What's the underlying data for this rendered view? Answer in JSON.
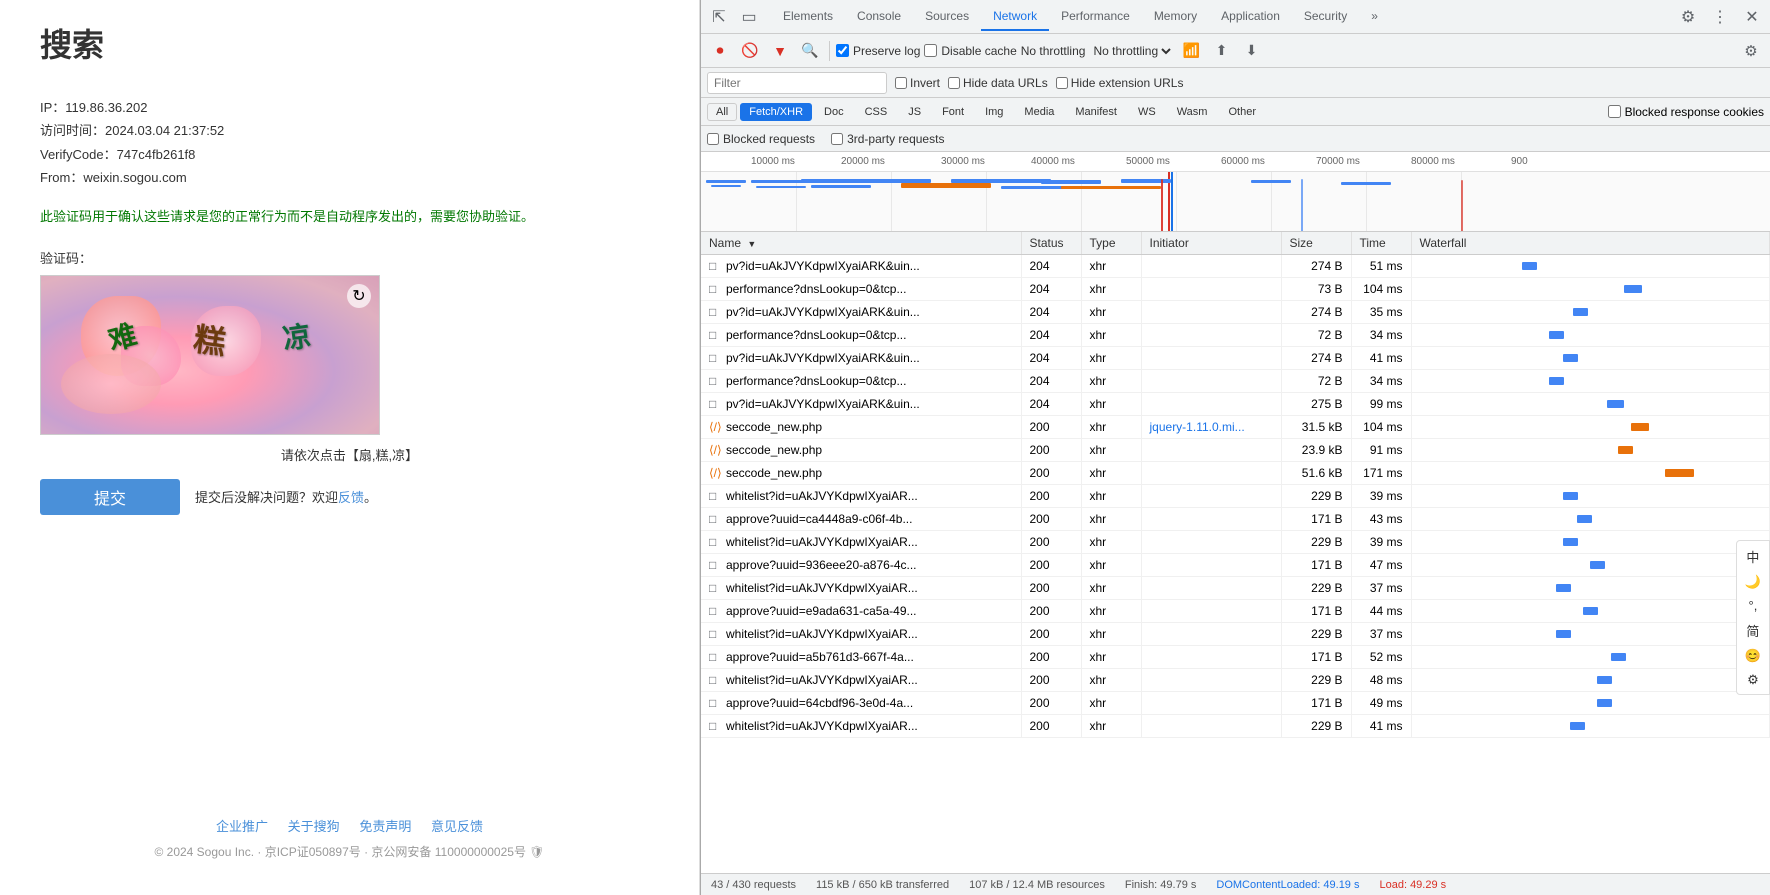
{
  "sogou": {
    "title": "搜索",
    "info": {
      "ip": "IP：119.86.36.202",
      "visit_time": "访问时间：2024.03.04 21:37:52",
      "verify_code": "VerifyCode：747c4fb261f8",
      "from": "From：weixin.sogou.com"
    },
    "description": "此验证码用于确认这些请求是您的正常行为而不是自动程序发出的，需要您协助验证。",
    "captcha_label": "验证码：",
    "captcha_chars": [
      "难",
      "糕",
      "凉"
    ],
    "captcha_instruction": "请依次点击【扇,糕,凉】",
    "submit_btn": "提交",
    "submit_hint": "提交后没解决问题？欢迎",
    "feedback_link": "反馈",
    "footer_links": [
      "企业推广",
      "关于搜狗",
      "免责声明",
      "意见反馈"
    ],
    "copyright": "© 2024 Sogou Inc. · 京ICP证050897号 · 京公网安备 110000000025号 🛡"
  },
  "devtools": {
    "tabs": [
      {
        "id": "elements",
        "label": "Elements",
        "active": false
      },
      {
        "id": "console",
        "label": "Console",
        "active": false
      },
      {
        "id": "sources",
        "label": "Sources",
        "active": false
      },
      {
        "id": "network",
        "label": "Network",
        "active": true
      },
      {
        "id": "performance",
        "label": "Performance",
        "active": false
      },
      {
        "id": "memory",
        "label": "Memory",
        "active": false
      },
      {
        "id": "application",
        "label": "Application",
        "active": false
      },
      {
        "id": "security",
        "label": "Security",
        "active": false
      }
    ],
    "toolbar": {
      "preserve_log_label": "Preserve log",
      "disable_cache_label": "Disable cache",
      "no_throttling_label": "No throttling"
    },
    "filter": {
      "placeholder": "Filter",
      "invert_label": "Invert",
      "hide_data_urls_label": "Hide data URLs",
      "hide_ext_urls_label": "Hide extension URLs"
    },
    "type_filters": [
      "All",
      "Fetch/XHR",
      "Doc",
      "CSS",
      "JS",
      "Font",
      "Img",
      "Media",
      "Manifest",
      "WS",
      "Wasm",
      "Other"
    ],
    "active_type_filter": "Fetch/XHR",
    "blocked_cookies_label": "Blocked response cookies",
    "extra_filters": [
      "Blocked requests",
      "3rd-party requests"
    ],
    "timeline_labels": [
      "10000 ms",
      "20000 ms",
      "30000 ms",
      "40000 ms",
      "50000 ms",
      "60000 ms",
      "70000 ms",
      "80000 ms",
      "900"
    ],
    "table": {
      "headers": [
        "Name",
        "Status",
        "Type",
        "Initiator",
        "Size",
        "Time",
        "Waterfall"
      ],
      "rows": [
        {
          "name": "pv?id=uAkJVYKdpwIXyaiARK&uin...",
          "status": "204",
          "type": "xhr",
          "initiator": "",
          "size": "274 B",
          "time": "51 ms",
          "is_xhr": false
        },
        {
          "name": "performance?dnsLookup=0&tcp...",
          "status": "204",
          "type": "xhr",
          "initiator": "",
          "size": "73 B",
          "time": "104 ms",
          "is_xhr": false
        },
        {
          "name": "pv?id=uAkJVYKdpwIXyaiARK&uin...",
          "status": "204",
          "type": "xhr",
          "initiator": "",
          "size": "274 B",
          "time": "35 ms",
          "is_xhr": false
        },
        {
          "name": "performance?dnsLookup=0&tcp...",
          "status": "204",
          "type": "xhr",
          "initiator": "",
          "size": "72 B",
          "time": "34 ms",
          "is_xhr": false
        },
        {
          "name": "pv?id=uAkJVYKdpwIXyaiARK&uin...",
          "status": "204",
          "type": "xhr",
          "initiator": "",
          "size": "274 B",
          "time": "41 ms",
          "is_xhr": false
        },
        {
          "name": "performance?dnsLookup=0&tcp...",
          "status": "204",
          "type": "xhr",
          "initiator": "",
          "size": "72 B",
          "time": "34 ms",
          "is_xhr": false
        },
        {
          "name": "pv?id=uAkJVYKdpwIXyaiARK&uin...",
          "status": "204",
          "type": "xhr",
          "initiator": "",
          "size": "275 B",
          "time": "99 ms",
          "is_xhr": false
        },
        {
          "name": "seccode_new.php",
          "status": "200",
          "type": "xhr",
          "initiator": "jquery-1.11.0.mi...",
          "size": "31.5 kB",
          "time": "104 ms",
          "is_xhr": true
        },
        {
          "name": "seccode_new.php",
          "status": "200",
          "type": "xhr",
          "initiator": "",
          "size": "23.9 kB",
          "time": "91 ms",
          "is_xhr": true
        },
        {
          "name": "seccode_new.php",
          "status": "200",
          "type": "xhr",
          "initiator": "",
          "size": "51.6 kB",
          "time": "171 ms",
          "is_xhr": true
        },
        {
          "name": "whitelist?id=uAkJVYKdpwIXyaiAR...",
          "status": "200",
          "type": "xhr",
          "initiator": "",
          "size": "229 B",
          "time": "39 ms",
          "is_xhr": false
        },
        {
          "name": "approve?uuid=ca4448a9-c06f-4b...",
          "status": "200",
          "type": "xhr",
          "initiator": "",
          "size": "171 B",
          "time": "43 ms",
          "is_xhr": false
        },
        {
          "name": "whitelist?id=uAkJVYKdpwIXyaiAR...",
          "status": "200",
          "type": "xhr",
          "initiator": "",
          "size": "229 B",
          "time": "39 ms",
          "is_xhr": false
        },
        {
          "name": "approve?uuid=936eee20-a876-4c...",
          "status": "200",
          "type": "xhr",
          "initiator": "",
          "size": "171 B",
          "time": "47 ms",
          "is_xhr": false
        },
        {
          "name": "whitelist?id=uAkJVYKdpwIXyaiAR...",
          "status": "200",
          "type": "xhr",
          "initiator": "",
          "size": "229 B",
          "time": "37 ms",
          "is_xhr": false
        },
        {
          "name": "approve?uuid=e9ada631-ca5a-49...",
          "status": "200",
          "type": "xhr",
          "initiator": "",
          "size": "171 B",
          "time": "44 ms",
          "is_xhr": false
        },
        {
          "name": "whitelist?id=uAkJVYKdpwIXyaiAR...",
          "status": "200",
          "type": "xhr",
          "initiator": "",
          "size": "229 B",
          "time": "37 ms",
          "is_xhr": false
        },
        {
          "name": "approve?uuid=a5b761d3-667f-4a...",
          "status": "200",
          "type": "xhr",
          "initiator": "",
          "size": "171 B",
          "time": "52 ms",
          "is_xhr": false
        },
        {
          "name": "whitelist?id=uAkJVYKdpwIXyaiAR...",
          "status": "200",
          "type": "xhr",
          "initiator": "",
          "size": "229 B",
          "time": "48 ms",
          "is_xhr": false
        },
        {
          "name": "approve?uuid=64cbdf96-3e0d-4a...",
          "status": "200",
          "type": "xhr",
          "initiator": "",
          "size": "171 B",
          "time": "49 ms",
          "is_xhr": false
        },
        {
          "name": "whitelist?id=uAkJVYKdpwIXyaiAR...",
          "status": "200",
          "type": "xhr",
          "initiator": "",
          "size": "229 B",
          "time": "41 ms",
          "is_xhr": false
        }
      ]
    },
    "status_bar": {
      "requests": "43 / 430 requests",
      "transferred": "115 kB / 650 kB transferred",
      "resources": "107 kB / 12.4 MB resources",
      "finish": "Finish: 49.79 s",
      "dom_content_loaded": "DOMContentLoaded: 49.19 s",
      "load": "Load: 49.29 s"
    }
  },
  "floating_panel": {
    "items": [
      "中",
      "🌙",
      "°,",
      "简",
      "😊",
      "⚙"
    ]
  }
}
